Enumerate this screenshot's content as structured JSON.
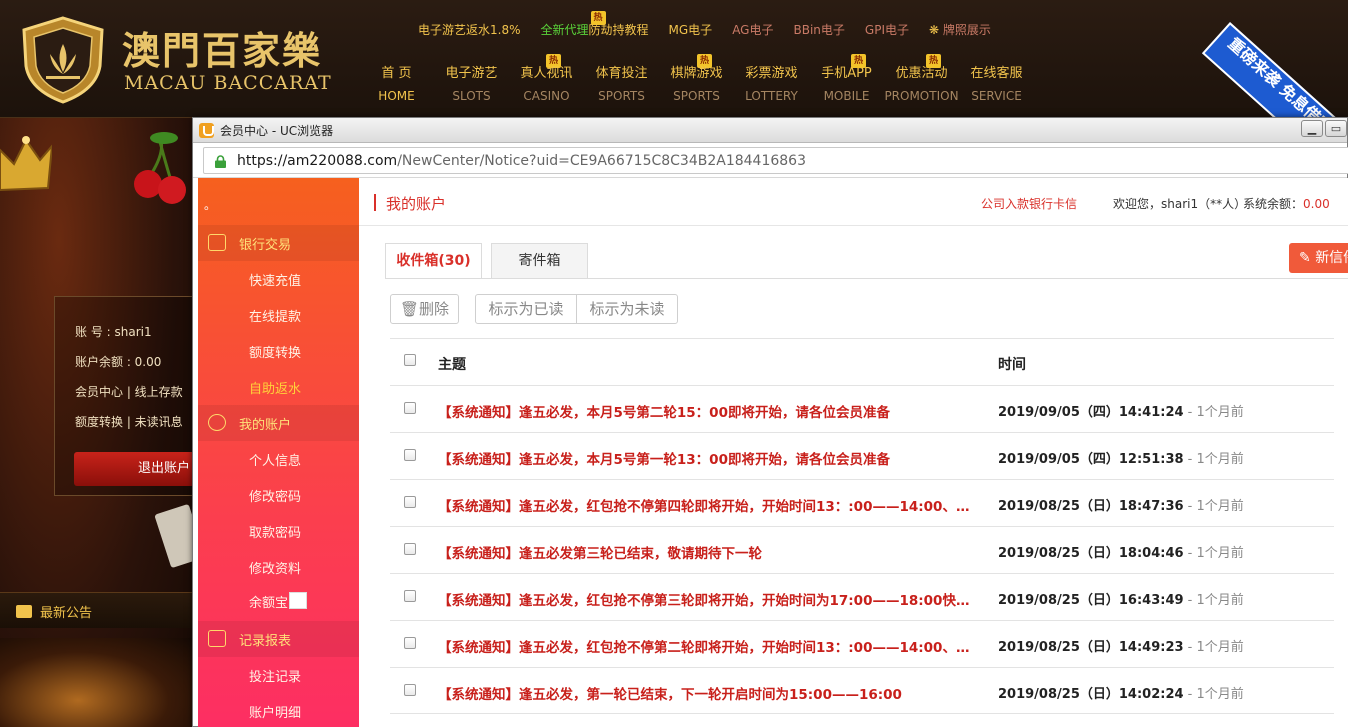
{
  "site": {
    "logo_cn": "澳門百家樂",
    "logo_en": "MACAU BACCARAT",
    "subnav": [
      {
        "label": "电子游艺返水1.8%",
        "color": "#f1c34c"
      },
      {
        "label": "全新代理",
        "color": "#5ad33a"
      },
      {
        "label": "防劫持教程",
        "color": "#f1c34c"
      },
      {
        "label": "MG电子",
        "color": "#f1c34c"
      },
      {
        "label": "AG电子",
        "color": "#c97a66"
      },
      {
        "label": "BBin电子",
        "color": "#c97a66"
      },
      {
        "label": "GPI电子",
        "color": "#c97a66"
      },
      {
        "label": "牌照展示",
        "color": "#c97a66"
      }
    ],
    "hot_label": "热",
    "mainnav": [
      {
        "cn": "首 页",
        "en": "HOME"
      },
      {
        "cn": "电子游艺",
        "en": "SLOTS"
      },
      {
        "cn": "真人视讯",
        "en": "CASINO"
      },
      {
        "cn": "体育投注",
        "en": "SPORTS"
      },
      {
        "cn": "棋牌游戏",
        "en": "SPORTS"
      },
      {
        "cn": "彩票游戏",
        "en": "LOTTERY"
      },
      {
        "cn": "手机APP",
        "en": "MOBILE"
      },
      {
        "cn": "优惠活动",
        "en": "PROMOTION"
      },
      {
        "cn": "在线客服",
        "en": "SERVICE"
      }
    ],
    "banner_text": "重磅来袭 免息借呗",
    "account": {
      "account_line": "账 号 : shari1",
      "balance_line": "账户余额 : 0.00",
      "links1": "会员中心 |  线上存款",
      "links2": "额度转换 |  未读讯息",
      "logout": "退出账户"
    },
    "notice_title": "最新公告"
  },
  "browser": {
    "title": "会员中心 - UC浏览器",
    "url_host": "https://am220088.com",
    "url_path": "/NewCenter/Notice?uid=CE9A66715C8C34B2A184416863",
    "min_btn": "▁",
    "max_btn": "▭"
  },
  "sidebar": {
    "dot": "。",
    "sections": [
      {
        "label": "银行交易",
        "items": [
          "快速充值",
          "在线提款",
          "额度转换",
          "自助返水"
        ]
      },
      {
        "label": "我的账户",
        "items": [
          "个人信息",
          "修改密码",
          "取款密码",
          "修改资料",
          "余额宝"
        ]
      },
      {
        "label": "记录报表",
        "items": [
          "投注记录",
          "账户明细"
        ]
      }
    ]
  },
  "header": {
    "title": "我的账户",
    "bank_link": "公司入款银行卡信",
    "welcome": "欢迎您，shari1（**人）",
    "balance_label": "系统余额：",
    "balance_value": "0.00"
  },
  "tabs": {
    "inbox": "收件箱(30)",
    "outbox": "寄件箱"
  },
  "new_button": "新信件",
  "toolbar": {
    "delete": "删除",
    "mark_read": "标示为已读",
    "mark_unread": "标示为未读"
  },
  "table": {
    "col_subject": "主题",
    "col_time": "时间",
    "rows": [
      {
        "subject": "【系统通知】逢五必发，本月5号第二轮15：00即将开始，请各位会员准备",
        "time": "2019/09/05（四）14:41:24",
        "ago": " - 1个月前"
      },
      {
        "subject": "【系统通知】逢五必发，本月5号第一轮13：00即将开始，请各位会员准备",
        "time": "2019/09/05（四）12:51:38",
        "ago": " - 1个月前"
      },
      {
        "subject": "【系统通知】逢五必发，红包抢不停第四轮即将开始，开始时间13：:00——14:00、…",
        "time": "2019/08/25（日）18:47:36",
        "ago": " - 1个月前"
      },
      {
        "subject": "【系统通知】逢五必发第三轮已结束，敬请期待下一轮",
        "time": "2019/08/25（日）18:04:46",
        "ago": " - 1个月前"
      },
      {
        "subject": "【系统通知】逢五必发，红包抢不停第三轮即将开始，开始时间为17:00——18:00快…",
        "time": "2019/08/25（日）16:43:49",
        "ago": " - 1个月前"
      },
      {
        "subject": "【系统通知】逢五必发，红包抢不停第二轮即将开始，开始时间13：:00——14:00、…",
        "time": "2019/08/25（日）14:49:23",
        "ago": " - 1个月前"
      },
      {
        "subject": "【系统通知】逢五必发，第一轮已结束，下一轮开启时间为15:00——16:00",
        "time": "2019/08/25（日）14:02:24",
        "ago": " - 1个月前"
      }
    ]
  },
  "colors": {
    "accent": "#d9302a",
    "gold": "#f1c34c",
    "sidebar_top": "#f6601e",
    "sidebar_bottom": "#fd2e63"
  }
}
